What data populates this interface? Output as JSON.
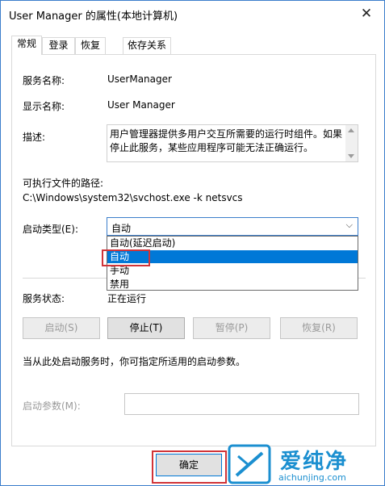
{
  "window": {
    "title": "User Manager 的属性(本地计算机)",
    "close_glyph": "✕"
  },
  "tabs": [
    {
      "label": "常规",
      "active": true
    },
    {
      "label": "登录",
      "active": false
    },
    {
      "label": "恢复",
      "active": false
    },
    {
      "label": "依存关系",
      "active": false
    }
  ],
  "general": {
    "service_name_label": "服务名称:",
    "service_name_value": "UserManager",
    "display_name_label": "显示名称:",
    "display_name_value": "User Manager",
    "description_label": "描述:",
    "description_value": "用户管理器提供多用户交互所需要的运行时组件。如果停止此服务，某些应用程序可能无法正确运行。",
    "exe_path_label": "可执行文件的路径:",
    "exe_path_value": "C:\\Windows\\system32\\svchost.exe -k netsvcs",
    "startup_type_label": "启动类型(E):",
    "startup_type_value": "自动",
    "startup_options": [
      "自动(延迟启动)",
      "自动",
      "手动",
      "禁用"
    ],
    "service_status_label": "服务状态:",
    "service_status_value": "正在运行",
    "buttons": {
      "start": "启动(S)",
      "stop": "停止(T)",
      "pause": "暂停(P)",
      "resume": "恢复(R)"
    },
    "hint": "当从此处启动服务时，你可指定所适用的启动参数。",
    "start_params_label": "启动参数(M):",
    "start_params_value": ""
  },
  "footer": {
    "ok_label": "确定"
  },
  "watermark": {
    "text": "爱纯净",
    "url": "aichunjing.com"
  },
  "colors": {
    "accent": "#0078d7",
    "highlight_box": "#d13438",
    "watermark": "#1b8fd0"
  }
}
